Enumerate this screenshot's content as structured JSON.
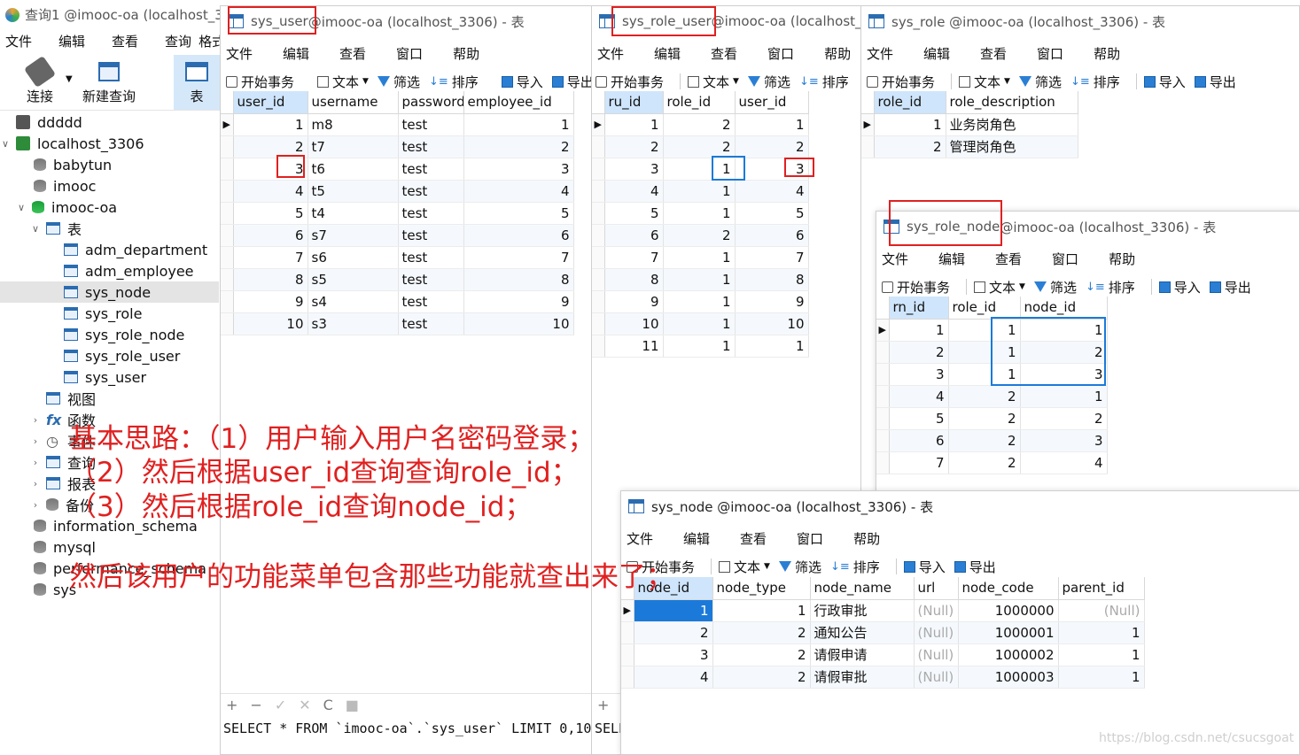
{
  "main": {
    "title": "查询1 @imooc-oa (localhost_3",
    "menu": [
      "文件",
      "编辑",
      "查看",
      "查询",
      "格式"
    ],
    "connect_label": "连接",
    "new_query_label": "新建查询",
    "table_label": "表",
    "tree": [
      {
        "label": "ddddd",
        "icon": "connection-icon"
      },
      {
        "label": "localhost_3306",
        "icon": "connection-icon"
      },
      {
        "label": "babytun",
        "icon": "database-icon"
      },
      {
        "label": "imooc",
        "icon": "database-icon"
      },
      {
        "label": "imooc-oa",
        "icon": "database-icon"
      },
      {
        "label": "表",
        "icon": "table-folder-icon"
      },
      {
        "label": "adm_department",
        "icon": "table-icon"
      },
      {
        "label": "adm_employee",
        "icon": "table-icon"
      },
      {
        "label": "sys_node",
        "icon": "table-icon"
      },
      {
        "label": "sys_role",
        "icon": "table-icon"
      },
      {
        "label": "sys_role_node",
        "icon": "table-icon"
      },
      {
        "label": "sys_role_user",
        "icon": "table-icon"
      },
      {
        "label": "sys_user",
        "icon": "table-icon"
      },
      {
        "label": "视图",
        "icon": "view-icon"
      },
      {
        "label": "函数",
        "icon": "function-icon"
      },
      {
        "label": "事件",
        "icon": "event-icon"
      },
      {
        "label": "查询",
        "icon": "query-icon"
      },
      {
        "label": "报表",
        "icon": "report-icon"
      },
      {
        "label": "备份",
        "icon": "backup-icon"
      },
      {
        "label": "information_schema",
        "icon": "database-icon"
      },
      {
        "label": "mysql",
        "icon": "database-icon"
      },
      {
        "label": "performance_schema",
        "icon": "database-icon"
      },
      {
        "label": "sys",
        "icon": "database-icon"
      }
    ]
  },
  "toolbar": {
    "begin": "开始事务",
    "text": "文本",
    "filter": "筛选",
    "sort": "排序",
    "import": "导入",
    "export": "导出"
  },
  "submenu": [
    "文件",
    "编辑",
    "查看",
    "窗口",
    "帮助"
  ],
  "sys_user": {
    "title_a": "sys_user",
    "title_b": " @imooc-oa (localhost_3306) - 表",
    "columns": [
      "user_id",
      "username",
      "password",
      "employee_id"
    ],
    "rows": [
      [
        "1",
        "m8",
        "test",
        "1"
      ],
      [
        "2",
        "t7",
        "test",
        "2"
      ],
      [
        "3",
        "t6",
        "test",
        "3"
      ],
      [
        "4",
        "t5",
        "test",
        "4"
      ],
      [
        "5",
        "t4",
        "test",
        "5"
      ],
      [
        "6",
        "s7",
        "test",
        "6"
      ],
      [
        "7",
        "s6",
        "test",
        "7"
      ],
      [
        "8",
        "s5",
        "test",
        "8"
      ],
      [
        "9",
        "s4",
        "test",
        "9"
      ],
      [
        "10",
        "s3",
        "test",
        "10"
      ]
    ],
    "status": "SELECT * FROM `imooc-oa`.`sys_user` LIMIT 0,1000",
    "bottom_buttons": [
      "+",
      "−",
      "✓",
      "✕",
      "C",
      "■"
    ]
  },
  "sys_role_user": {
    "title_a": "sys_role_user",
    "title_b": " @imooc-oa (localhost_",
    "columns": [
      "ru_id",
      "role_id",
      "user_id"
    ],
    "rows": [
      [
        "1",
        "2",
        "1"
      ],
      [
        "2",
        "2",
        "2"
      ],
      [
        "3",
        "1",
        "3"
      ],
      [
        "4",
        "1",
        "4"
      ],
      [
        "5",
        "1",
        "5"
      ],
      [
        "6",
        "2",
        "6"
      ],
      [
        "7",
        "1",
        "7"
      ],
      [
        "8",
        "1",
        "8"
      ],
      [
        "9",
        "1",
        "9"
      ],
      [
        "10",
        "1",
        "10"
      ],
      [
        "11",
        "1",
        "1"
      ]
    ],
    "status": "SELE"
  },
  "sys_role": {
    "title": "sys_role @imooc-oa (localhost_3306) - 表",
    "columns": [
      "role_id",
      "role_description"
    ],
    "rows": [
      [
        "1",
        "业务岗角色"
      ],
      [
        "2",
        "管理岗角色"
      ]
    ]
  },
  "sys_role_node": {
    "title_a": "sys_role_node",
    "title_b": " @imooc-oa (localhost_3306) - 表",
    "columns": [
      "rn_id",
      "role_id",
      "node_id"
    ],
    "rows": [
      [
        "1",
        "1",
        "1"
      ],
      [
        "2",
        "1",
        "2"
      ],
      [
        "3",
        "1",
        "3"
      ],
      [
        "4",
        "2",
        "1"
      ],
      [
        "5",
        "2",
        "2"
      ],
      [
        "6",
        "2",
        "3"
      ],
      [
        "7",
        "2",
        "4"
      ]
    ]
  },
  "sys_node": {
    "title": "sys_node @imooc-oa (localhost_3306) - 表",
    "columns": [
      "node_id",
      "node_type",
      "node_name",
      "url",
      "node_code",
      "parent_id"
    ],
    "rows": [
      [
        "1",
        "1 行政审批",
        "(Null)",
        "1000000",
        "(Null)"
      ],
      [
        "2",
        "2 通知公告",
        "(Null)",
        "1000001",
        "1"
      ],
      [
        "3",
        "2 请假申请",
        "(Null)",
        "1000002",
        "1"
      ],
      [
        "4",
        "2 请假审批",
        "(Null)",
        "1000003",
        "1"
      ]
    ]
  },
  "annotation": {
    "line1": "基本思路：（1）用户输入用户名密码登录；",
    "line2": "（2）然后根据user_id查询查询role_id；",
    "line3": "（3）然后根据role_id查询node_id；",
    "line4": "然后该用户的功能菜单包含那些功能就查出来了；"
  },
  "watermark": "https://blog.csdn.net/csucsgoat",
  "colors": {
    "red": "#e02020",
    "blue": "#1b7ad9"
  }
}
